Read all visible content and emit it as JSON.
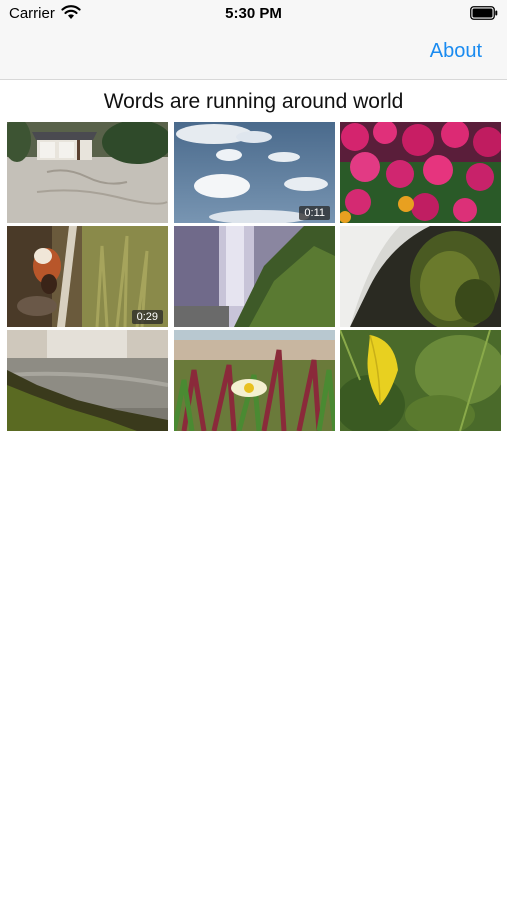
{
  "status_bar": {
    "carrier": "Carrier",
    "time": "5:30 PM"
  },
  "nav": {
    "about_label": "About"
  },
  "page": {
    "title": "Words are running around world"
  },
  "grid": {
    "items": [
      {
        "subject": "japanese garden house",
        "duration": ""
      },
      {
        "subject": "clouds in blue sky",
        "duration": "0:11"
      },
      {
        "subject": "pink flowers",
        "duration": ""
      },
      {
        "subject": "red panda on log",
        "duration": "0:29"
      },
      {
        "subject": "waterfall and green cliff",
        "duration": ""
      },
      {
        "subject": "waterfall on mossy rock",
        "duration": ""
      },
      {
        "subject": "river rapids over rocks",
        "duration": ""
      },
      {
        "subject": "ice plant flower",
        "duration": ""
      },
      {
        "subject": "yellow leaf in greenery",
        "duration": ""
      }
    ]
  },
  "colors": {
    "accent": "#1a8bf0",
    "bar_background": "#f7f7f7"
  }
}
